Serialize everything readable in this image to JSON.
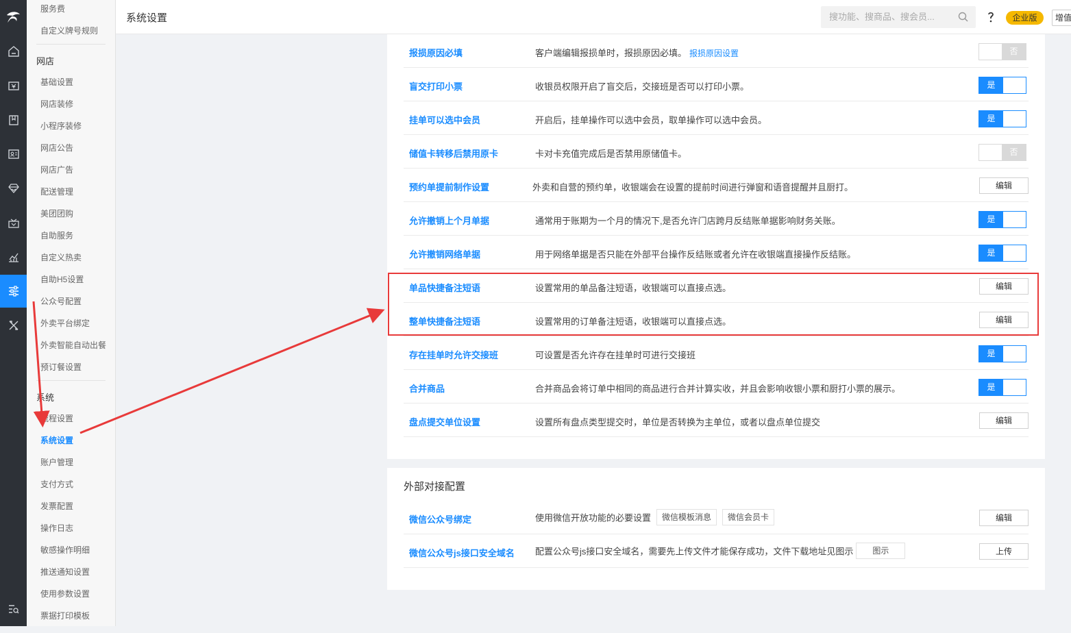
{
  "header": {
    "title": "系统设置",
    "search_placeholder": "搜功能、搜商品、搜会员...",
    "edition": "企业版",
    "value_added": "增值"
  },
  "rail": {
    "icons": [
      "logo",
      "home-icon",
      "money-icon",
      "book-icon",
      "member-card-icon",
      "diamond-icon",
      "gift-icon",
      "chart-icon",
      "settings-sliders-icon",
      "tools-icon",
      "menu-search-icon"
    ],
    "active": "settings-sliders-icon",
    "accent": "#1a8cff"
  },
  "submenu": {
    "top_items": [
      "服务费",
      "自定义牌号规则"
    ],
    "groups": [
      {
        "title": "网店",
        "items": [
          "基础设置",
          "网店装修",
          "小程序装修",
          "网店公告",
          "网店广告",
          "配送管理",
          "美团团购",
          "自助服务",
          "自定义热卖",
          "自助H5设置",
          "公众号配置",
          "外卖平台绑定",
          "外卖智能自动出餐",
          "预订餐设置"
        ]
      },
      {
        "title": "系统",
        "items": [
          "流程设置",
          "系统设置",
          "账户管理",
          "支付方式",
          "发票配置",
          "操作日志",
          "敏感操作明细",
          "推送通知设置",
          "使用参数设置",
          "票据打印模板"
        ]
      }
    ],
    "active_item": "系统设置"
  },
  "settings": {
    "rows": [
      {
        "name": "报损原因必填",
        "desc": "客户端编辑报损单时，报损原因必填。",
        "link": "报损原因设置",
        "control": "toggle",
        "state": "否"
      },
      {
        "name": "盲交打印小票",
        "desc": "收银员权限开启了盲交后，交接班是否可以打印小票。",
        "control": "toggle",
        "state": "是"
      },
      {
        "name": "挂单可以选中会员",
        "desc": "开启后，挂单操作可以选中会员，取单操作可以选中会员。",
        "control": "toggle",
        "state": "是"
      },
      {
        "name": "储值卡转移后禁用原卡",
        "desc": "卡对卡充值完成后是否禁用原储值卡。",
        "control": "toggle",
        "state": "否"
      },
      {
        "name": "预约单提前制作设置",
        "desc": "外卖和自营的预约单，收银端会在设置的提前时间进行弹窗和语音提醒并且厨打。",
        "control": "button",
        "button": "编辑"
      },
      {
        "name": "允许撤销上个月单据",
        "desc": "通常用于账期为一个月的情况下,是否允许门店跨月反结账单据影响财务关账。",
        "control": "toggle",
        "state": "是"
      },
      {
        "name": "允许撤销网络单据",
        "desc": "用于网络单据是否只能在外部平台操作反结账或者允许在收银端直接操作反结账。",
        "control": "toggle",
        "state": "是"
      },
      {
        "name": "单品快捷备注短语",
        "desc": "设置常用的单品备注短语，收银端可以直接点选。",
        "control": "button",
        "button": "编辑"
      },
      {
        "name": "整单快捷备注短语",
        "desc": "设置常用的订单备注短语，收银端可以直接点选。",
        "control": "button",
        "button": "编辑"
      },
      {
        "name": "存在挂单时允许交接班",
        "desc": "可设置是否允许存在挂单时可进行交接班",
        "control": "toggle",
        "state": "是"
      },
      {
        "name": "合并商品",
        "desc": "合并商品会将订单中相同的商品进行合并计算实收，并且会影响收银小票和厨打小票的展示。",
        "control": "toggle",
        "state": "是"
      },
      {
        "name": "盘点提交单位设置",
        "desc": "设置所有盘点类型提交时，单位是否转换为主单位，或者以盘点单位提交",
        "control": "button",
        "button": "编辑"
      }
    ]
  },
  "external": {
    "title": "外部对接配置",
    "rows": [
      {
        "name": "微信公众号绑定",
        "desc": "使用微信开放功能的必要设置",
        "tags": [
          "微信模板消息",
          "微信会员卡"
        ],
        "button": "编辑"
      },
      {
        "name": "微信公众号js接口安全域名",
        "desc": "配置公众号js接口安全域名，需要先上传文件才能保存成功，文件下载地址见图示",
        "tags": [
          "图示"
        ],
        "button": "上传"
      }
    ]
  },
  "annotation": {
    "highlight_color": "#e83a3a"
  }
}
